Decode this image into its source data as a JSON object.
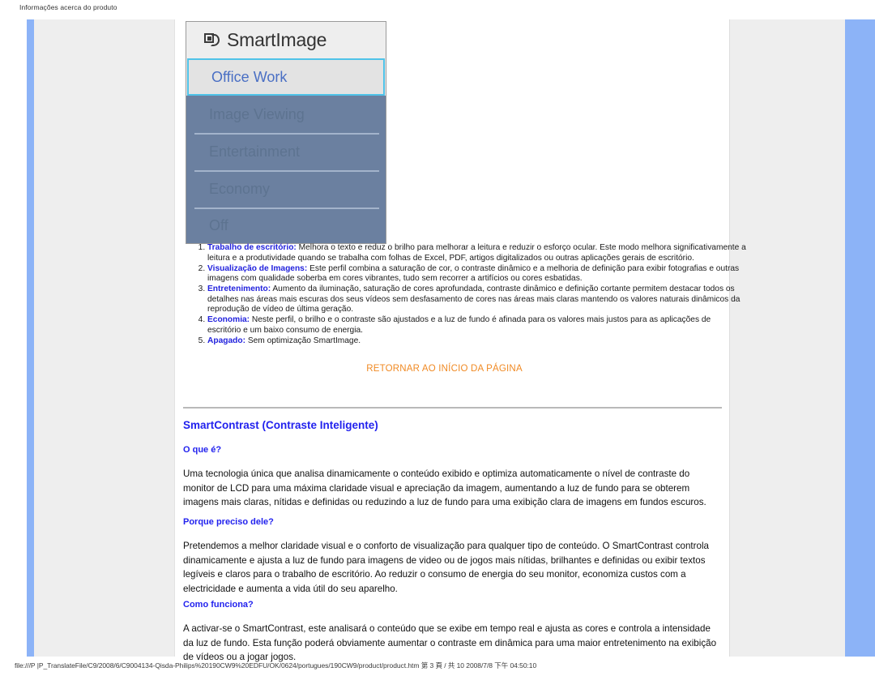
{
  "print_header": "Informações acerca do produto",
  "smartimage": {
    "title": "SmartImage",
    "icon": "smartimage-logo-icon",
    "selected_option": "Office Work",
    "options": [
      "Image Viewing",
      "Entertainment",
      "Economy",
      "Off"
    ],
    "accent_border": "#4fc3e8",
    "panel_bg": "#6b80a0"
  },
  "features": [
    {
      "term": "Trabalho de escritório:",
      "text": " Melhora o texto e reduz o brilho para melhorar a leitura e reduzir o esforço ocular. Este modo melhora significativamente a leitura e a produtividade quando se trabalha com folhas de Excel, PDF, artigos digitalizados ou outras aplicações gerais de escritório."
    },
    {
      "term": "Visualização de Imagens:",
      "text": " Este perfil combina a saturação de cor, o contraste dinâmico e a melhoria de definição para exibir fotografias e outras imagens com qualidade soberba em cores vibrantes, tudo sem recorrer a artifícios ou cores esbatidas."
    },
    {
      "term": "Entretenimento:",
      "text": " Aumento da iluminação, saturação de cores aprofundada, contraste dinâmico e definição cortante permitem destacar todos os detalhes nas áreas mais escuras dos seus vídeos sem desfasamento de cores nas áreas mais claras mantendo os valores naturais dinâmicos da reprodução de vídeo de última geração."
    },
    {
      "term": "Economia:",
      "text": " Neste perfil, o brilho e o contraste são ajustados e a luz de fundo é afinada para os valores mais justos para as aplicações de escritório e um baixo consumo de energia."
    },
    {
      "term": "Apagado:",
      "text": " Sem optimização SmartImage."
    }
  ],
  "return_link": "RETORNAR AO INÍCIO DA PÁGINA",
  "sections": {
    "smartcontrast_heading": "SmartContrast (Contraste Inteligente)",
    "q1_heading": "O que é?",
    "q1_body": "Uma tecnologia única que analisa dinamicamente o conteúdo exibido e optimiza automaticamente o nível de contraste do monitor de LCD para uma máxima claridade visual e apreciação da imagem, aumentando a luz de fundo para se obterem imagens mais claras, nítidas e definidas ou reduzindo a luz de fundo para uma exibição clara de imagens em fundos escuros.",
    "q2_heading": "Porque preciso dele?",
    "q2_body": "Pretendemos a melhor claridade visual e o conforto de visualização para qualquer tipo de conteúdo. O SmartContrast controla dinamicamente e ajusta a luz de fundo para imagens de video ou de jogos mais nítidas, brilhantes e definidas ou exibir textos legíveis e claros para o trabalho de escritório. Ao reduzir o consumo de energia do seu monitor, economiza custos com a electricidade e aumenta a vida útil do seu aparelho.",
    "q3_heading": "Como funciona?",
    "q3_body": "A activar-se o SmartContrast, este analisará o conteúdo que se exibe em tempo real e ajusta as cores e controla a intensidade da luz de fundo. Esta função poderá obviamente aumentar o contraste em dinâmica para uma maior entretenimento na exibição de vídeos ou a jogar jogos."
  },
  "footer": "file:///P |P_TranslateFile/C9/2008/6/C9004134-Qisda-Philips%20190CW9%20EDFU/OK/0624/portugues/190CW9/product/product.htm 第 3 頁 / 共 10 2008/7/8 下午 04:50:10"
}
